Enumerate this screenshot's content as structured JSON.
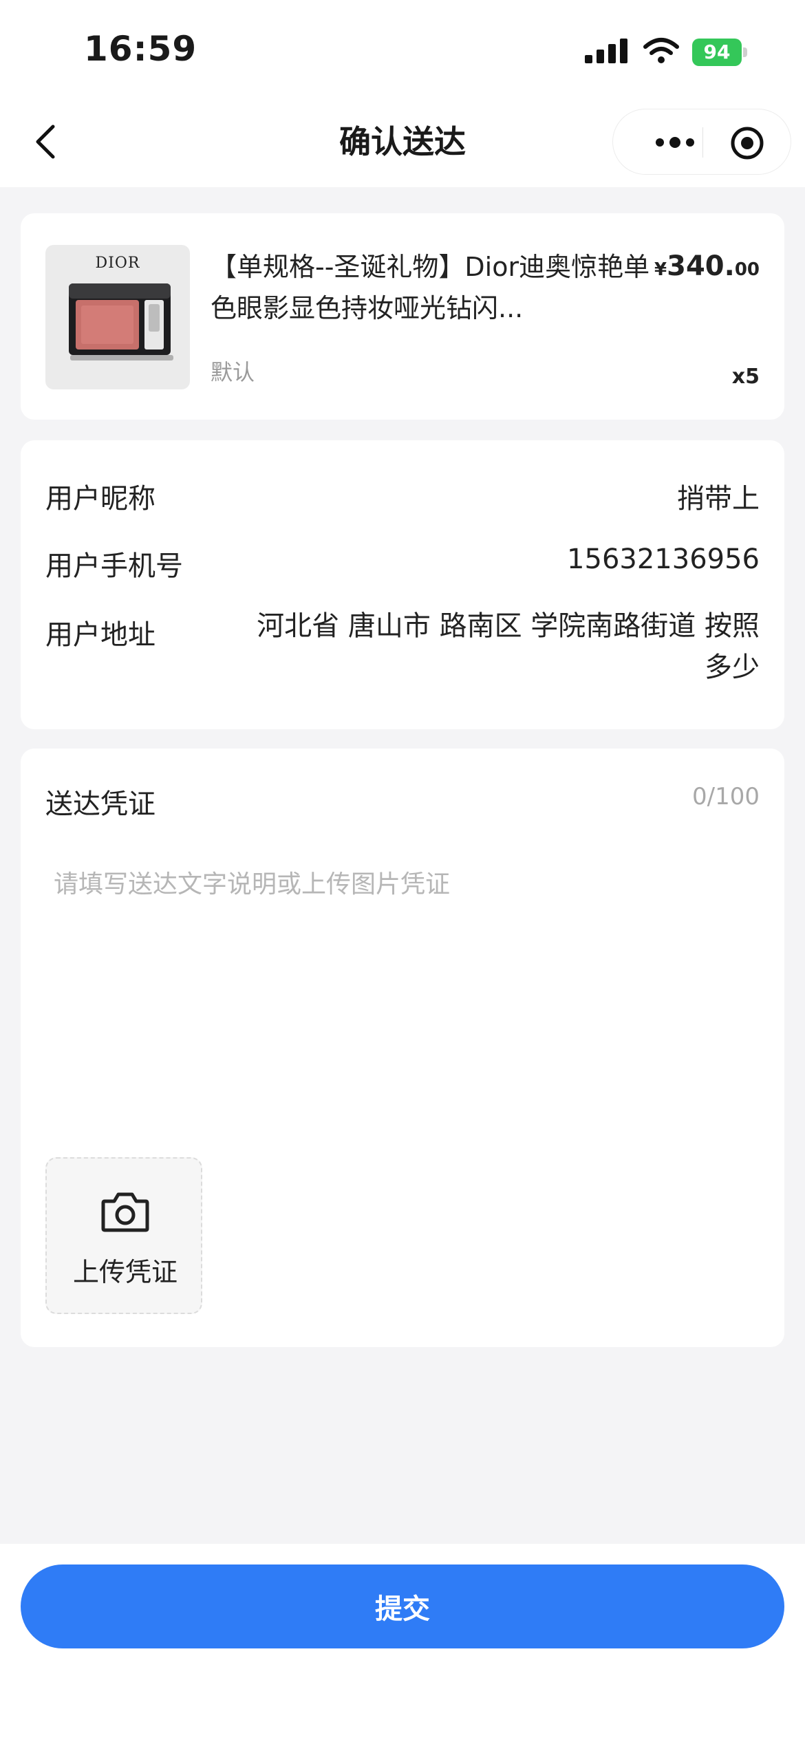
{
  "status_bar": {
    "time": "16:59",
    "battery": "94"
  },
  "nav": {
    "title": "确认送达"
  },
  "product": {
    "brand": "DIOR",
    "title": "【单规格--圣诞礼物】Dior迪奥惊艳单色眼影显色持妆哑光钻闪...",
    "price_currency": "¥",
    "price_int": "340.",
    "price_dec": "00",
    "spec": "默认",
    "quantity": "x5"
  },
  "user_info": {
    "nickname_label": "用户昵称",
    "nickname": "捎带上",
    "phone_label": "用户手机号",
    "phone": "15632136956",
    "address_label": "用户地址",
    "address": "河北省 唐山市 路南区 学院南路街道 按照多少"
  },
  "proof": {
    "title": "送达凭证",
    "count": "0/100",
    "placeholder": "请填写送达文字说明或上传图片凭证",
    "upload_label": "上传凭证"
  },
  "submit_label": "提交",
  "colors": {
    "accent": "#2f7cf6",
    "background": "#f4f4f6",
    "battery": "#34c759"
  },
  "icons": [
    "back-chevron-icon",
    "more-dots-icon",
    "record-target-icon",
    "camera-icon",
    "signal-icon",
    "wifi-icon",
    "battery-icon"
  ]
}
